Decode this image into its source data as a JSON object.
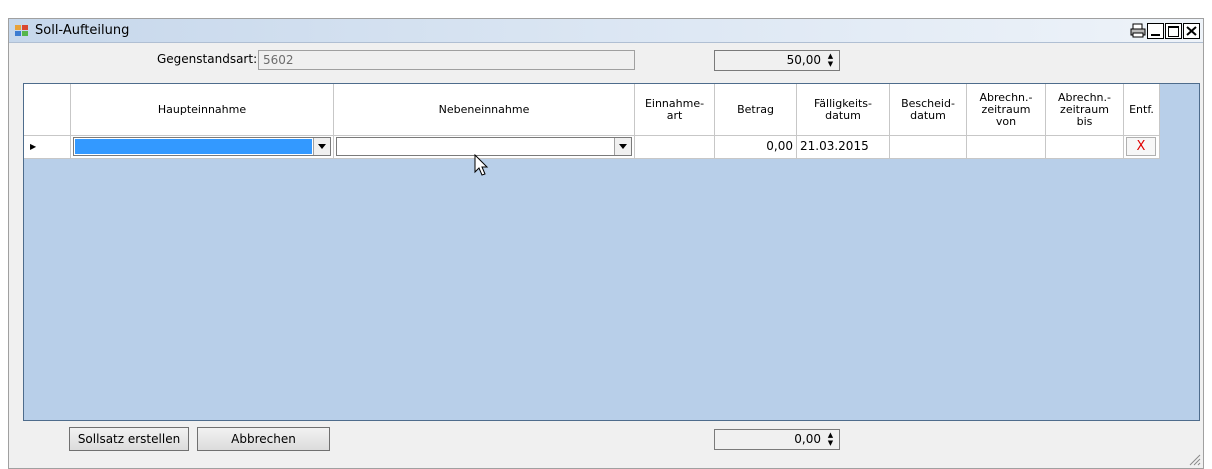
{
  "window": {
    "title": "Soll-Aufteilung",
    "controls": [
      "print",
      "minimize",
      "maximize",
      "close"
    ]
  },
  "header": {
    "gegenstandsart_label": "Gegenstandsart:",
    "gegenstandsart_value": "5602",
    "spin_value": "50,00"
  },
  "grid": {
    "columns": [
      "Haupteinnahme",
      "Nebeneinnahme",
      "Einnahme-\nart",
      "Betrag",
      "Fälligkeits-\ndatum",
      "Bescheid-\ndatum",
      "Abrechn.-\nzeitraum\nvon",
      "Abrechn.-\nzeitraum\nbis",
      "Entf."
    ],
    "row": {
      "haupteinnahme": "",
      "nebeneinnahme": "",
      "einnahmeart": "",
      "betrag": "0,00",
      "faelligkeitsdatum": "21.03.2015",
      "bescheiddatum": "",
      "zeitraum_von": "",
      "zeitraum_bis": "",
      "entf": "X"
    }
  },
  "footer": {
    "sollsatz_button": "Sollsatz erstellen",
    "abbrechen_button": "Abbrechen",
    "total_value": "0,00"
  },
  "colors": {
    "grid_background": "#b8cfe9",
    "selection": "#3399ff",
    "delete": "#e00000"
  }
}
